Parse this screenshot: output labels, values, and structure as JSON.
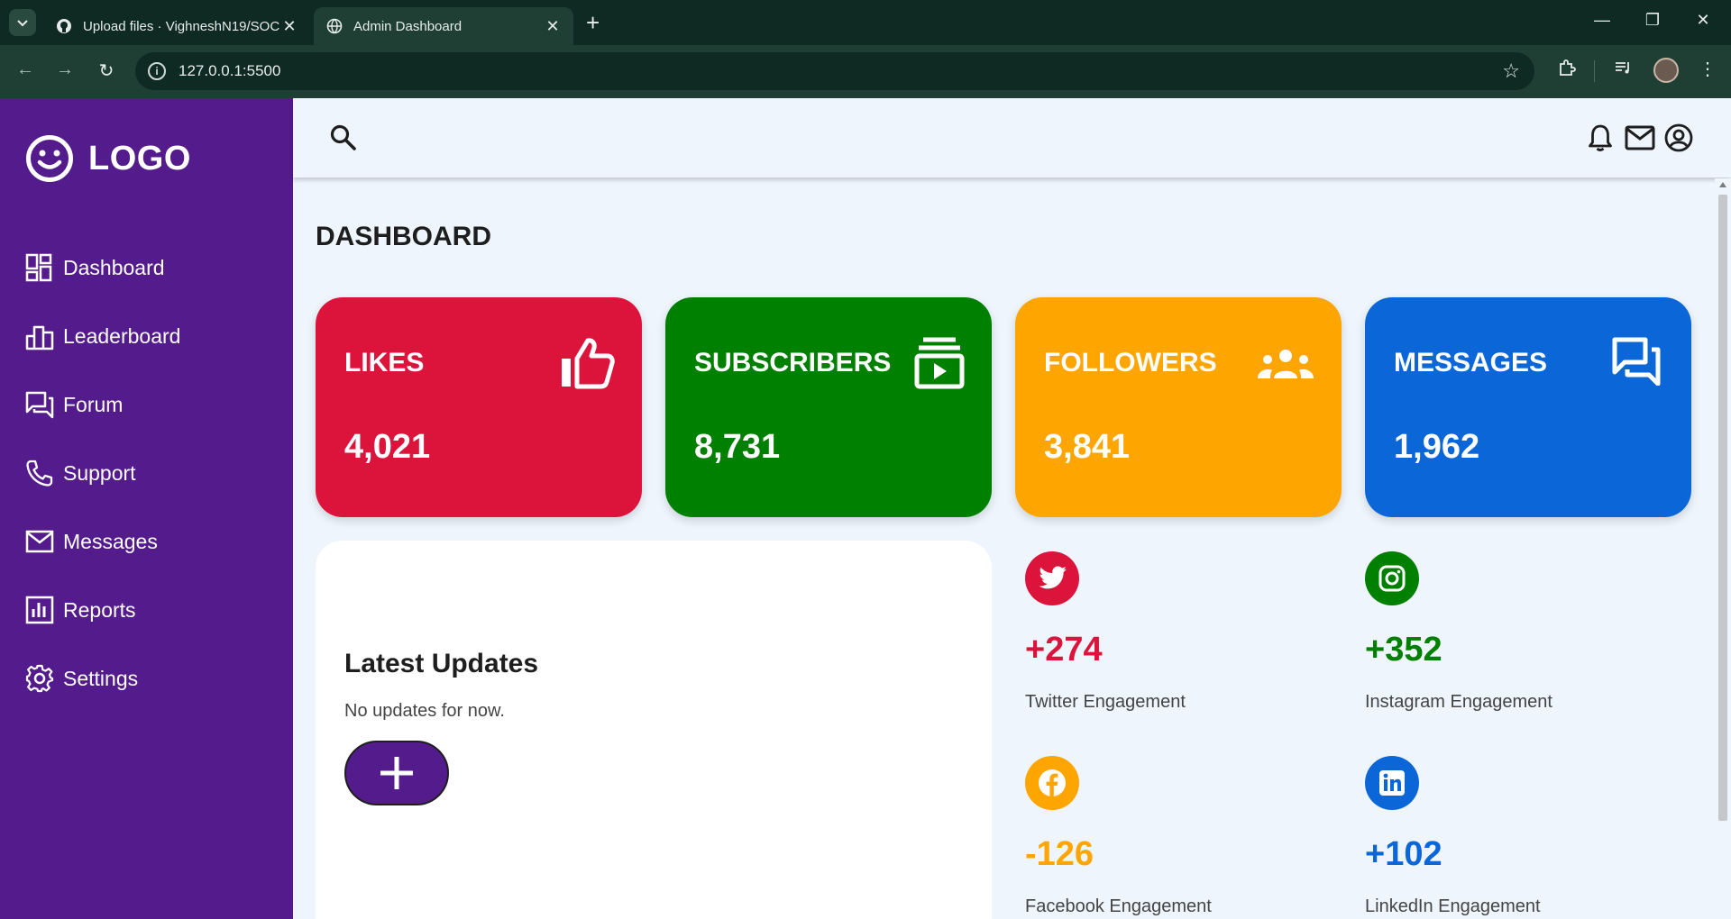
{
  "browser": {
    "tabs": [
      {
        "title": "Upload files · VighneshN19/SOC",
        "active": false
      },
      {
        "title": "Admin Dashboard",
        "active": true
      }
    ],
    "url": "127.0.0.1:5500"
  },
  "sidebar": {
    "logo": "LOGO",
    "items": [
      {
        "label": "Dashboard",
        "icon": "dashboard-icon"
      },
      {
        "label": "Leaderboard",
        "icon": "leaderboard-icon"
      },
      {
        "label": "Forum",
        "icon": "forum-icon"
      },
      {
        "label": "Support",
        "icon": "phone-icon"
      },
      {
        "label": "Messages",
        "icon": "mail-icon"
      },
      {
        "label": "Reports",
        "icon": "reports-icon"
      },
      {
        "label": "Settings",
        "icon": "gear-icon"
      }
    ]
  },
  "header": {
    "icons": [
      "search-icon",
      "bell-icon",
      "mail-icon",
      "account-icon"
    ]
  },
  "main": {
    "title": "DASHBOARD",
    "cards": [
      {
        "title": "LIKES",
        "value": "4,021",
        "color": "#dc143c",
        "icon": "thumbs-up-icon"
      },
      {
        "title": "SUBSCRIBERS",
        "value": "8,731",
        "color": "#008000",
        "icon": "subscriptions-icon"
      },
      {
        "title": "FOLLOWERS",
        "value": "3,841",
        "color": "#ffa500",
        "icon": "group-icon"
      },
      {
        "title": "MESSAGES",
        "value": "1,962",
        "color": "#0b66d8",
        "icon": "forum-icon"
      }
    ],
    "updates": {
      "title": "Latest Updates",
      "text": "No updates for now."
    },
    "engagement": [
      {
        "value": "+274",
        "label": "Twitter Engagement",
        "color": "#dc143c",
        "icon": "twitter-icon"
      },
      {
        "value": "+352",
        "label": "Instagram Engagement",
        "color": "#008000",
        "icon": "instagram-icon"
      },
      {
        "value": "-126",
        "label": "Facebook Engagement",
        "color": "#ffa500",
        "icon": "facebook-icon"
      },
      {
        "value": "+102",
        "label": "LinkedIn Engagement",
        "color": "#0b66d8",
        "icon": "linkedin-icon"
      }
    ]
  }
}
